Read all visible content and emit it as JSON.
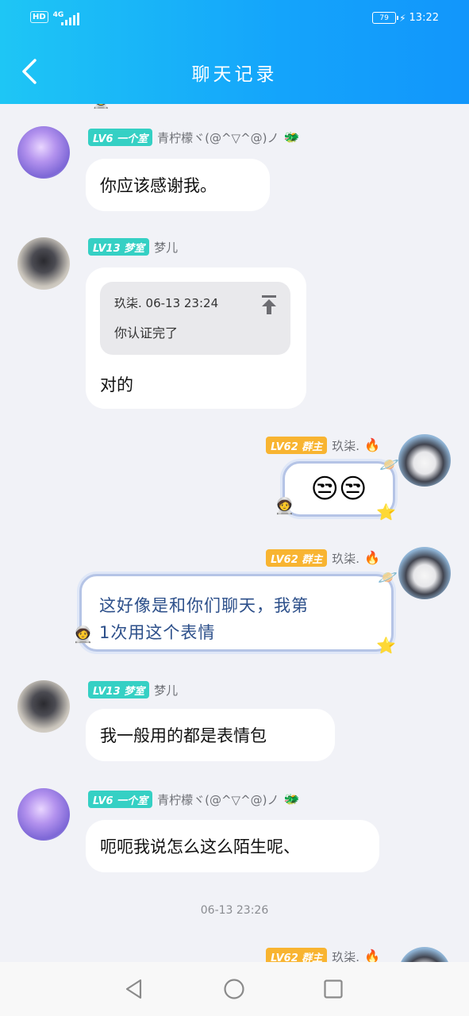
{
  "status_bar": {
    "hd": "HD",
    "network": "4G",
    "battery": "79",
    "time": "13:22"
  },
  "header": {
    "title": "聊天记录"
  },
  "messages": [
    {
      "badge": "LV6 一个室",
      "nick": "青柠檬ヾ(@^▽^@)ノ",
      "nick_emoji": "🐲",
      "text": "你应该感谢我。"
    },
    {
      "badge": "LV13 梦室",
      "nick": "梦儿",
      "quote_head": "玖柒. 06-13 23:24",
      "quote_text": "你认证完了",
      "text": "对的"
    },
    {
      "badge": "LV62 群主",
      "nick": "玖柒.",
      "nick_emoji": "🔥",
      "text": "😒😒"
    },
    {
      "badge": "LV62 群主",
      "nick": "玖柒.",
      "nick_emoji": "🔥",
      "text_line1": "这好像是和你们聊天，我第",
      "text_line2": "1次用这个表情"
    },
    {
      "badge": "LV13 梦室",
      "nick": "梦儿",
      "text": "我一般用的都是表情包"
    },
    {
      "badge": "LV6 一个室",
      "nick": "青柠檬ヾ(@^▽^@)ノ",
      "nick_emoji": "🐲",
      "text": "呃呃我说怎么这么陌生呢、"
    },
    {
      "badge": "LV62 群主",
      "nick": "玖柒.",
      "nick_emoji": "🔥"
    }
  ],
  "timestamp": "06-13 23:26",
  "icons": {
    "back": "chevron-left-icon",
    "quote": "jump-to-top-icon",
    "nav": [
      "back-triangle-icon",
      "home-circle-icon",
      "recents-square-icon"
    ]
  },
  "colors": {
    "header_gradient_start": "#1ec6f5",
    "header_gradient_end": "#1296fb",
    "badge_teal": "#35d0c4",
    "badge_gold": "#f8b431",
    "fancy_text": "#2c4f8a",
    "background": "#f1f2f7"
  }
}
